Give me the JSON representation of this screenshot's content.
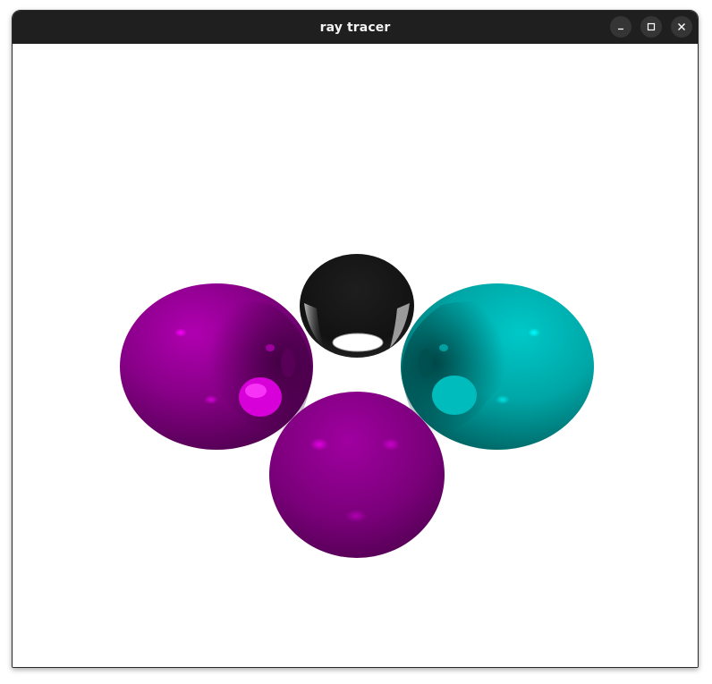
{
  "window": {
    "title": "ray tracer",
    "controls": {
      "minimize_icon": "minimize-icon",
      "maximize_icon": "maximize-icon",
      "close_icon": "close-icon"
    }
  },
  "scene": {
    "background": "#ffffff",
    "spheres": [
      {
        "name": "magenta-sphere-left",
        "color": "#8b008b",
        "highlight": "#ff00ff"
      },
      {
        "name": "black-sphere-back",
        "color": "#151515",
        "highlight": "#ffffff"
      },
      {
        "name": "cyan-sphere-right",
        "color": "#00a8a8",
        "highlight": "#00ffff"
      },
      {
        "name": "magenta-sphere-front",
        "color": "#800080",
        "highlight": "#e600e6"
      }
    ]
  }
}
